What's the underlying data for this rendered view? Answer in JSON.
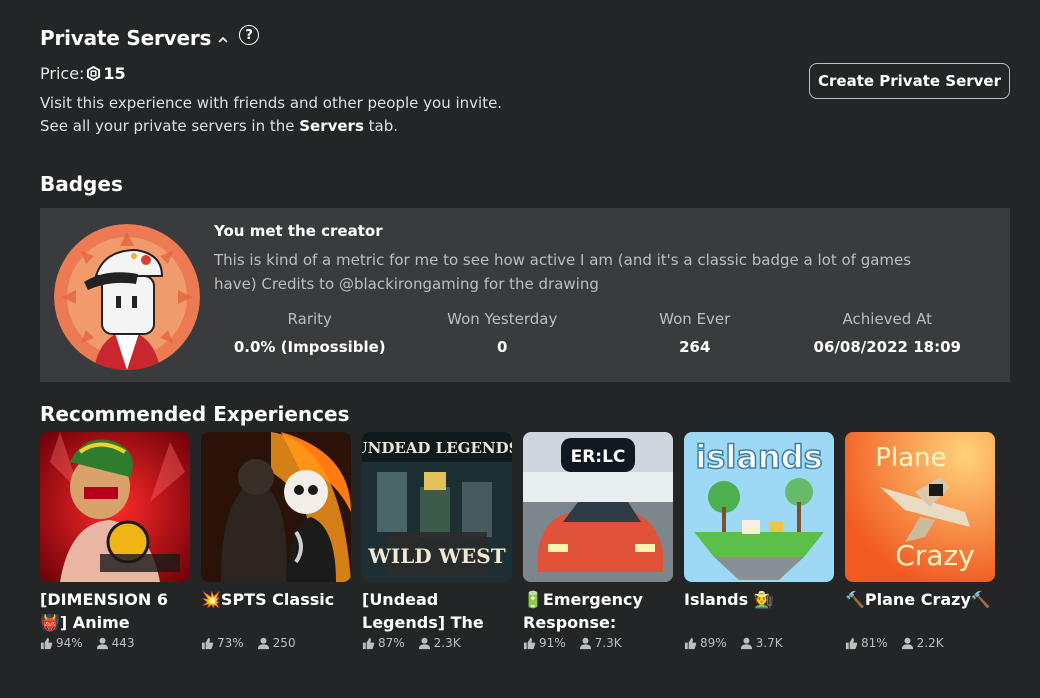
{
  "private_servers": {
    "title": "Private Servers",
    "help_glyph": "?",
    "price_label": "Price:",
    "price_value": "15",
    "desc_line1": "Visit this experience with friends and other people you invite.",
    "desc_line2_pre": "See all your private servers in the ",
    "desc_line2_bold": "Servers",
    "desc_line2_post": " tab.",
    "create_button": "Create Private Server"
  },
  "badges": {
    "title": "Badges",
    "badge": {
      "name": "You met the creator",
      "description": "This is kind of a metric for me to see how active I am (and it's a classic badge a lot of games have) Credits to @blackirongaming for the drawing",
      "stats": [
        {
          "label": "Rarity",
          "value": "0.0% (Impossible)"
        },
        {
          "label": "Won Yesterday",
          "value": "0"
        },
        {
          "label": "Won Ever",
          "value": "264"
        },
        {
          "label": "Achieved At",
          "value": "06/08/2022 18:09"
        }
      ]
    }
  },
  "recommended": {
    "title": "Recommended Experiences",
    "games": [
      {
        "name": "[DIMENSION 6 👹] Anime",
        "rating": "94%",
        "players": "443",
        "thumb_text": ""
      },
      {
        "name": "💥SPTS Classic",
        "rating": "73%",
        "players": "250",
        "thumb_text": ""
      },
      {
        "name": "[Undead Legends] The",
        "rating": "87%",
        "players": "2.3K",
        "thumb_text": "UNDEAD LEGENDS",
        "thumb_text2": "WILD WEST"
      },
      {
        "name": "🔋Emergency Response:",
        "rating": "91%",
        "players": "7.3K",
        "thumb_text": "ER:LC"
      },
      {
        "name": "Islands 🧑‍🌾",
        "rating": "89%",
        "players": "3.7K",
        "thumb_text": "islands"
      },
      {
        "name": "🔨Plane Crazy🔨",
        "rating": "81%",
        "players": "2.2K",
        "thumb_text": "Plane",
        "thumb_text2": "Crazy"
      }
    ]
  }
}
